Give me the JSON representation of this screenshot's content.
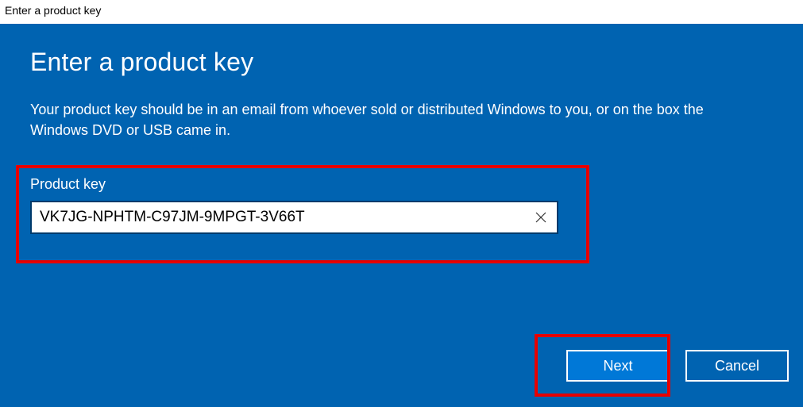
{
  "window": {
    "title": "Enter a product key"
  },
  "dialog": {
    "heading": "Enter a product key",
    "description": "Your product key should be in an email from whoever sold or distributed Windows to you, or on the box the Windows DVD or USB came in.",
    "field_label": "Product key",
    "field_value": "VK7JG-NPHTM-C97JM-9MPGT-3V66T",
    "buttons": {
      "next": "Next",
      "cancel": "Cancel"
    }
  }
}
